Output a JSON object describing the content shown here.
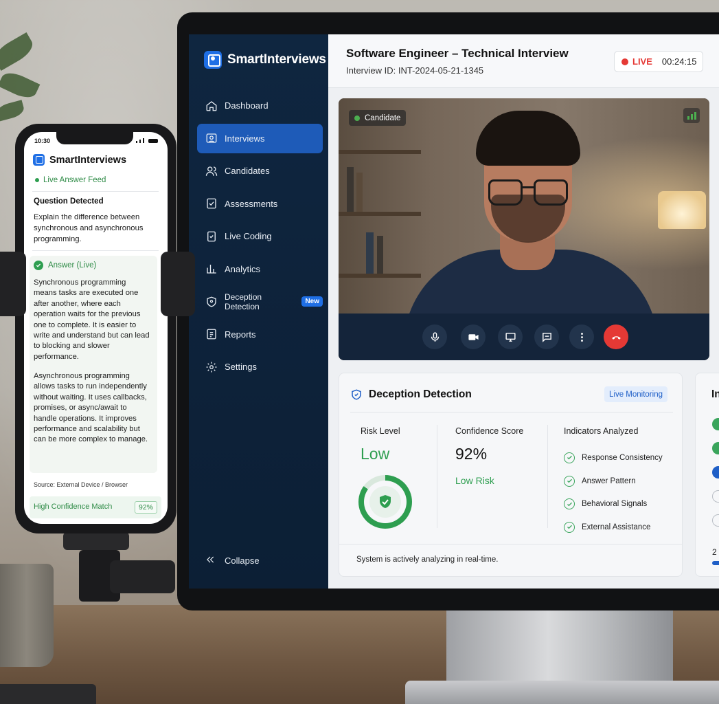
{
  "desktop_app": {
    "brand": "SmartInterviews",
    "nav": [
      {
        "label": "Dashboard",
        "icon": "home-icon"
      },
      {
        "label": "Interviews",
        "icon": "video-camera-icon",
        "active": true
      },
      {
        "label": "Candidates",
        "icon": "users-icon"
      },
      {
        "label": "Assessments",
        "icon": "checklist-icon"
      },
      {
        "label": "Live Coding",
        "icon": "code-check-icon"
      },
      {
        "label": "Analytics",
        "icon": "bar-chart-icon"
      },
      {
        "label": "Deception Detection",
        "icon": "shield-icon",
        "badge": "New"
      },
      {
        "label": "Reports",
        "icon": "report-icon"
      },
      {
        "label": "Settings",
        "icon": "gear-icon"
      }
    ],
    "collapse_label": "Collapse",
    "header": {
      "title": "Software Engineer – Technical Interview",
      "interview_id": "Interview ID: INT-2024-05-21-1345",
      "live_label": "LIVE",
      "elapsed": "00:24:15"
    },
    "video": {
      "candidate_tag": "Candidate",
      "controls": [
        "microphone-icon",
        "camera-icon",
        "screen-share-icon",
        "chat-icon",
        "more-icon",
        "end-call-icon"
      ]
    },
    "deception_panel": {
      "title": "Deception Detection",
      "status_badge": "Live Monitoring",
      "risk_label": "Risk Level",
      "risk_value": "Low",
      "risk_level_fraction": 0.85,
      "confidence_label": "Confidence Score",
      "confidence_value": "92%",
      "confidence_risk": "Low Risk",
      "indicators_label": "Indicators Analyzed",
      "indicators": [
        "Response Consistency",
        "Answer Pattern",
        "Behavioral Signals",
        "External Assistance"
      ],
      "footer": "System is actively analyzing in real-time."
    },
    "right_panel": {
      "title_partial": "In",
      "number_partial": "2"
    },
    "colors": {
      "sidebar": "#0f2640",
      "accent": "#1f6fe5",
      "success": "#2e9e50",
      "live": "#e53935"
    }
  },
  "phone_app": {
    "time": "10:30",
    "brand": "SmartInterviews",
    "feed_label": "Live Answer Feed",
    "question_title": "Question Detected",
    "question_text": "Explain the difference between synchronous and asynchronous programming.",
    "answer_title": "Answer (Live)",
    "answer_p1": "Synchronous programming means tasks are executed one after another, where each operation waits for the previous one to complete. It is easier to write and understand but can lead to blocking and slower performance.",
    "answer_p2": "Asynchronous programming allows tasks to run independently without waiting. It uses callbacks, promises, or async/await to handle operations. It improves performance and scalability but can be more complex to manage.",
    "source": "Source: External Device / Browser",
    "match_label": "High Confidence Match",
    "match_value": "92%"
  }
}
